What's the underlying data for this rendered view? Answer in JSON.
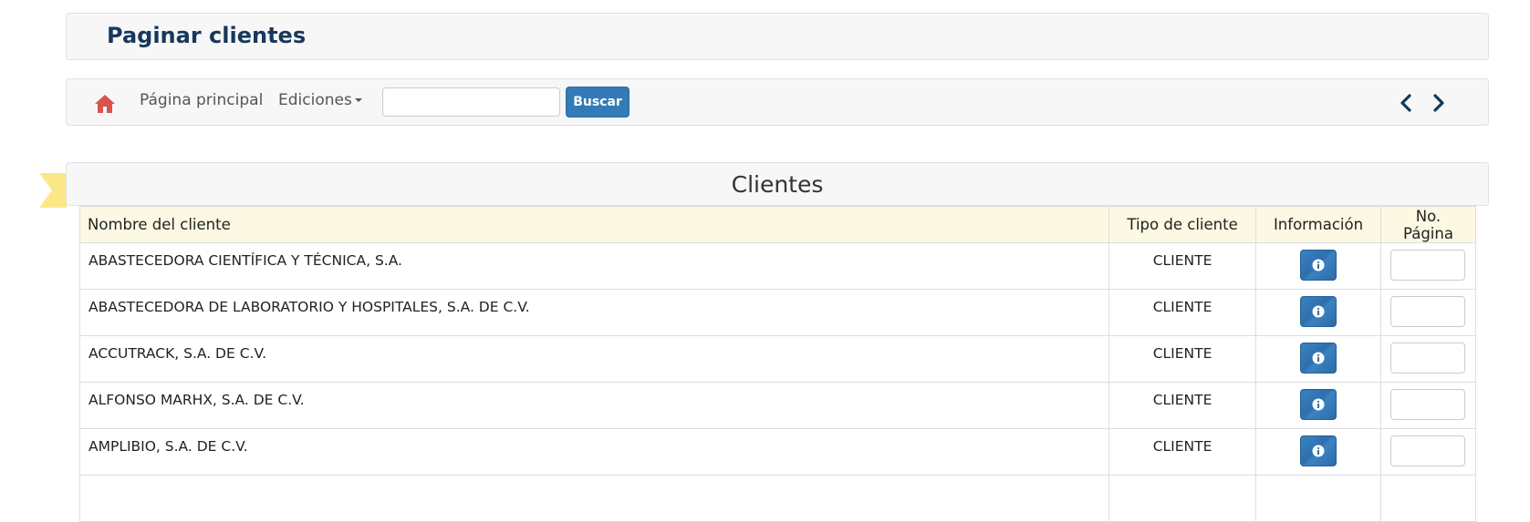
{
  "header": {
    "title": "Paginar clientes"
  },
  "nav": {
    "home_label": "Página principal",
    "ediciones_label": "Ediciones",
    "search_value": "",
    "search_button_label": "Buscar",
    "icons": {
      "home": "home-icon",
      "prev": "chevron-left-icon",
      "next": "chevron-right-icon"
    },
    "colors": {
      "home_icon": "#d9534f",
      "primary": "#337ab7",
      "title": "#17385c"
    }
  },
  "table": {
    "title": "Clientes",
    "columns": [
      "Nombre del cliente",
      "Tipo de cliente",
      "Información",
      "No. Página"
    ],
    "rows": [
      {
        "name": "ABASTECEDORA CIENTÍFICA Y TÉCNICA, S.A.",
        "type": "CLIENTE",
        "page": ""
      },
      {
        "name": "ABASTECEDORA DE LABORATORIO Y HOSPITALES, S.A. DE C.V.",
        "type": "CLIENTE",
        "page": ""
      },
      {
        "name": "ACCUTRACK, S.A. DE C.V.",
        "type": "CLIENTE",
        "page": ""
      },
      {
        "name": "ALFONSO MARHX, S.A. DE C.V.",
        "type": "CLIENTE",
        "page": ""
      },
      {
        "name": "AMPLIBIO, S.A. DE C.V.",
        "type": "CLIENTE",
        "page": ""
      }
    ]
  }
}
